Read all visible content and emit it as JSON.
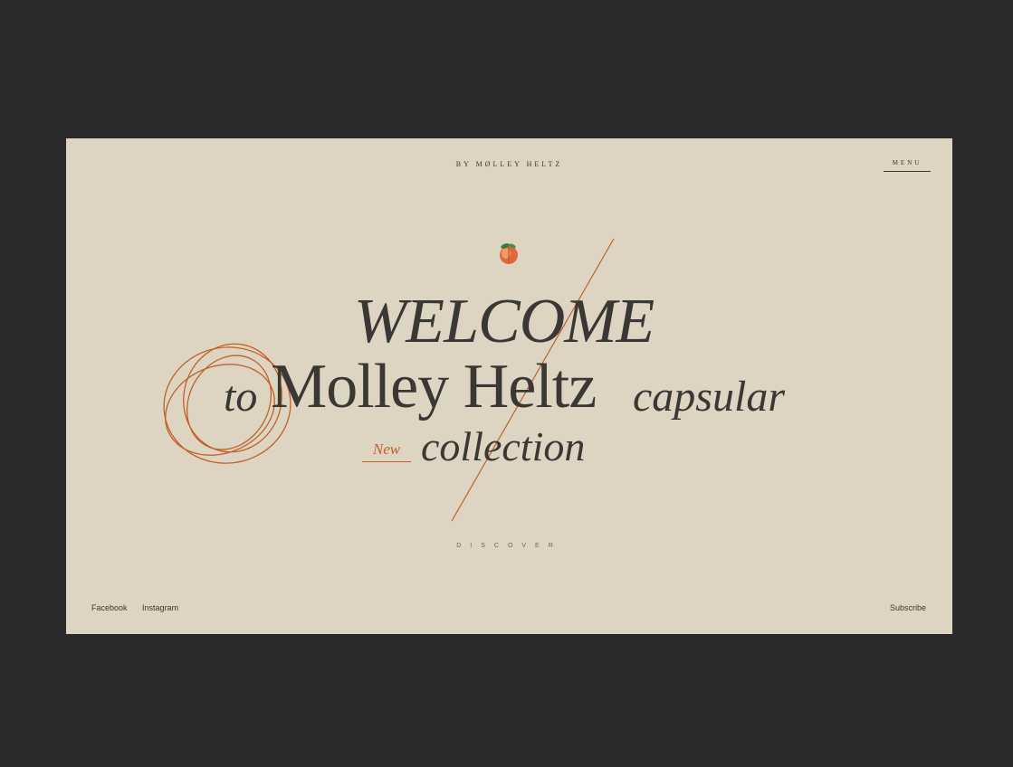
{
  "header": {
    "brand": "BY MØLLEY HELTZ",
    "menu_label": "MENU"
  },
  "hero": {
    "line1": "WELCOME",
    "to": "to",
    "name": "Molley Heltz",
    "capsular": "capsular",
    "new_tag": "New",
    "collection": "collection",
    "icon": "peach-icon"
  },
  "discover_label": "DISCOVER",
  "footer": {
    "social": [
      "Facebook",
      "Instagram"
    ],
    "subscribe": "Subscribe"
  },
  "colors": {
    "page_background": "#2a2a2a",
    "frame_background": "#ddd5c2",
    "text": "#3a3835",
    "accent": "#c0612a"
  }
}
